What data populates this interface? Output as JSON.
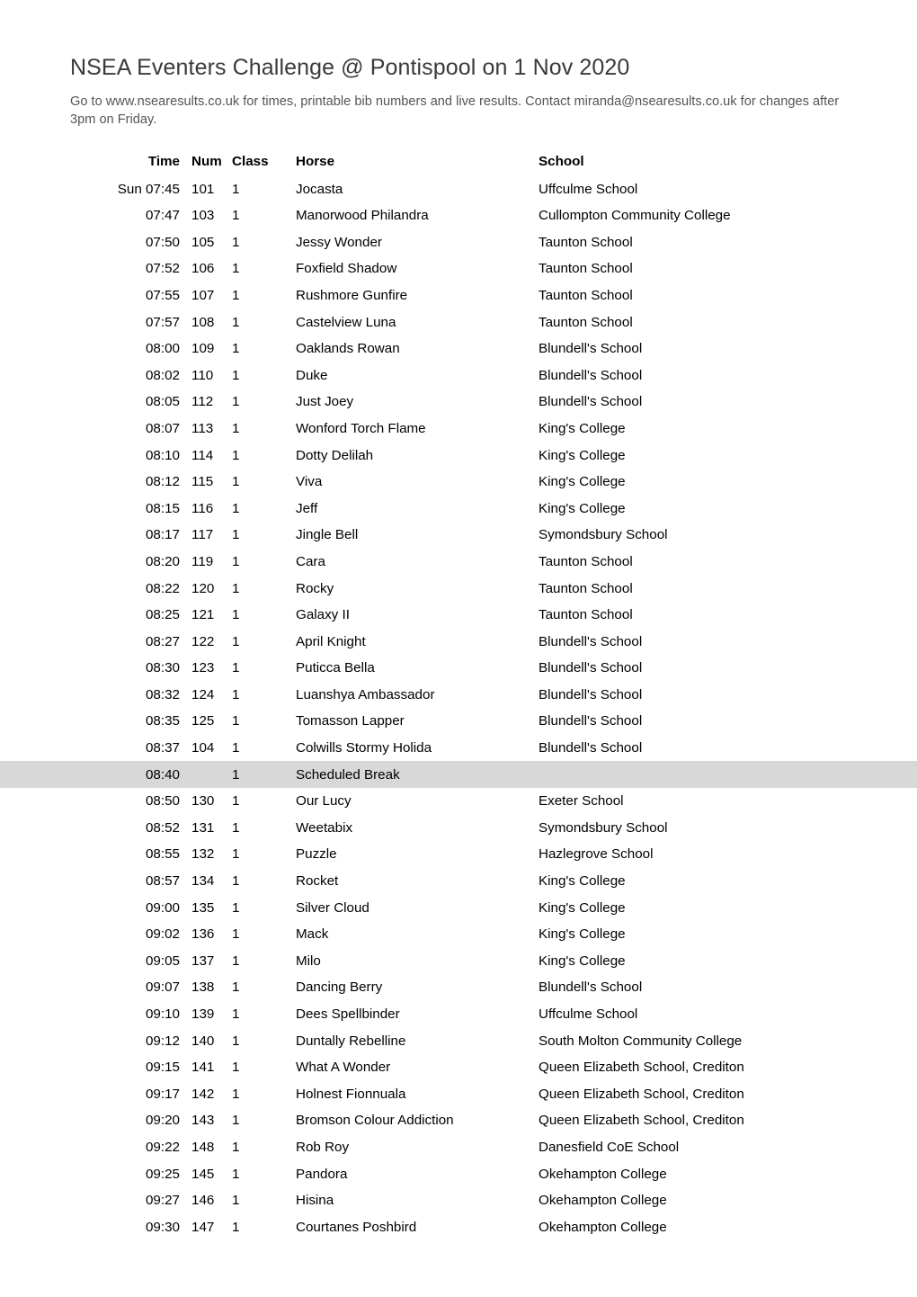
{
  "document": {
    "title": "NSEA Eventers Challenge @ Pontispool on 1 Nov 2020",
    "subtitle": "Go to www.nsearesults.co.uk for times, printable bib numbers and live results. Contact miranda@nsearesults.co.uk for changes after 3pm on Friday."
  },
  "table": {
    "columns": {
      "time": "Time",
      "num": "Num",
      "class": "Class",
      "horse": "Horse",
      "school": "School"
    },
    "break_row_color": "#d8d8d8",
    "rows": [
      {
        "time": "Sun 07:45",
        "num": "101",
        "class": "1",
        "horse": "Jocasta",
        "school": "Uffculme School",
        "is_break": false
      },
      {
        "time": "07:47",
        "num": "103",
        "class": "1",
        "horse": "Manorwood Philandra",
        "school": "Cullompton Community College",
        "is_break": false
      },
      {
        "time": "07:50",
        "num": "105",
        "class": "1",
        "horse": "Jessy Wonder",
        "school": "Taunton School",
        "is_break": false
      },
      {
        "time": "07:52",
        "num": "106",
        "class": "1",
        "horse": "Foxfield Shadow",
        "school": "Taunton School",
        "is_break": false
      },
      {
        "time": "07:55",
        "num": "107",
        "class": "1",
        "horse": "Rushmore Gunfire",
        "school": "Taunton School",
        "is_break": false
      },
      {
        "time": "07:57",
        "num": "108",
        "class": "1",
        "horse": "Castelview Luna",
        "school": "Taunton School",
        "is_break": false
      },
      {
        "time": "08:00",
        "num": "109",
        "class": "1",
        "horse": "Oaklands Rowan",
        "school": "Blundell's School",
        "is_break": false
      },
      {
        "time": "08:02",
        "num": "110",
        "class": "1",
        "horse": "Duke",
        "school": "Blundell's School",
        "is_break": false
      },
      {
        "time": "08:05",
        "num": "112",
        "class": "1",
        "horse": "Just Joey",
        "school": "Blundell's School",
        "is_break": false
      },
      {
        "time": "08:07",
        "num": "113",
        "class": "1",
        "horse": "Wonford Torch Flame",
        "school": "King's College",
        "is_break": false
      },
      {
        "time": "08:10",
        "num": "114",
        "class": "1",
        "horse": "Dotty Delilah",
        "school": "King's College",
        "is_break": false
      },
      {
        "time": "08:12",
        "num": "115",
        "class": "1",
        "horse": "Viva",
        "school": "King's College",
        "is_break": false
      },
      {
        "time": "08:15",
        "num": "116",
        "class": "1",
        "horse": "Jeff",
        "school": "King's College",
        "is_break": false
      },
      {
        "time": "08:17",
        "num": "117",
        "class": "1",
        "horse": "Jingle Bell",
        "school": "Symondsbury School",
        "is_break": false
      },
      {
        "time": "08:20",
        "num": "119",
        "class": "1",
        "horse": "Cara",
        "school": "Taunton School",
        "is_break": false
      },
      {
        "time": "08:22",
        "num": "120",
        "class": "1",
        "horse": "Rocky",
        "school": "Taunton School",
        "is_break": false
      },
      {
        "time": "08:25",
        "num": "121",
        "class": "1",
        "horse": "Galaxy II",
        "school": "Taunton School",
        "is_break": false
      },
      {
        "time": "08:27",
        "num": "122",
        "class": "1",
        "horse": "April Knight",
        "school": "Blundell's School",
        "is_break": false
      },
      {
        "time": "08:30",
        "num": "123",
        "class": "1",
        "horse": "Puticca Bella",
        "school": "Blundell's School",
        "is_break": false
      },
      {
        "time": "08:32",
        "num": "124",
        "class": "1",
        "horse": "Luanshya Ambassador",
        "school": "Blundell's School",
        "is_break": false
      },
      {
        "time": "08:35",
        "num": "125",
        "class": "1",
        "horse": "Tomasson Lapper",
        "school": "Blundell's School",
        "is_break": false
      },
      {
        "time": "08:37",
        "num": "104",
        "class": "1",
        "horse": "Colwills Stormy Holida",
        "school": "Blundell's School",
        "is_break": false
      },
      {
        "time": "08:40",
        "num": "",
        "class": "1",
        "horse": "Scheduled Break",
        "school": "",
        "is_break": true
      },
      {
        "time": "08:50",
        "num": "130",
        "class": "1",
        "horse": "Our Lucy",
        "school": "Exeter School",
        "is_break": false
      },
      {
        "time": "08:52",
        "num": "131",
        "class": "1",
        "horse": "Weetabix",
        "school": "Symondsbury School",
        "is_break": false
      },
      {
        "time": "08:55",
        "num": "132",
        "class": "1",
        "horse": "Puzzle",
        "school": "Hazlegrove School",
        "is_break": false
      },
      {
        "time": "08:57",
        "num": "134",
        "class": "1",
        "horse": "Rocket",
        "school": "King's College",
        "is_break": false
      },
      {
        "time": "09:00",
        "num": "135",
        "class": "1",
        "horse": "Silver Cloud",
        "school": "King's College",
        "is_break": false
      },
      {
        "time": "09:02",
        "num": "136",
        "class": "1",
        "horse": "Mack",
        "school": "King's College",
        "is_break": false
      },
      {
        "time": "09:05",
        "num": "137",
        "class": "1",
        "horse": "Milo",
        "school": "King's College",
        "is_break": false
      },
      {
        "time": "09:07",
        "num": "138",
        "class": "1",
        "horse": "Dancing Berry",
        "school": "Blundell's School",
        "is_break": false
      },
      {
        "time": "09:10",
        "num": "139",
        "class": "1",
        "horse": "Dees Spellbinder",
        "school": "Uffculme School",
        "is_break": false
      },
      {
        "time": "09:12",
        "num": "140",
        "class": "1",
        "horse": "Duntally Rebelline",
        "school": "South Molton Community College",
        "is_break": false
      },
      {
        "time": "09:15",
        "num": "141",
        "class": "1",
        "horse": "What A Wonder",
        "school": "Queen Elizabeth School, Crediton",
        "is_break": false
      },
      {
        "time": "09:17",
        "num": "142",
        "class": "1",
        "horse": "Holnest Fionnuala",
        "school": "Queen Elizabeth School, Crediton",
        "is_break": false
      },
      {
        "time": "09:20",
        "num": "143",
        "class": "1",
        "horse": "Bromson Colour Addiction",
        "school": "Queen Elizabeth School, Crediton",
        "is_break": false
      },
      {
        "time": "09:22",
        "num": "148",
        "class": "1",
        "horse": "Rob Roy",
        "school": "Danesfield CoE School",
        "is_break": false
      },
      {
        "time": "09:25",
        "num": "145",
        "class": "1",
        "horse": "Pandora",
        "school": "Okehampton College",
        "is_break": false
      },
      {
        "time": "09:27",
        "num": "146",
        "class": "1",
        "horse": "Hisina",
        "school": "Okehampton College",
        "is_break": false
      },
      {
        "time": "09:30",
        "num": "147",
        "class": "1",
        "horse": "Courtanes Poshbird",
        "school": "Okehampton College",
        "is_break": false
      }
    ]
  }
}
